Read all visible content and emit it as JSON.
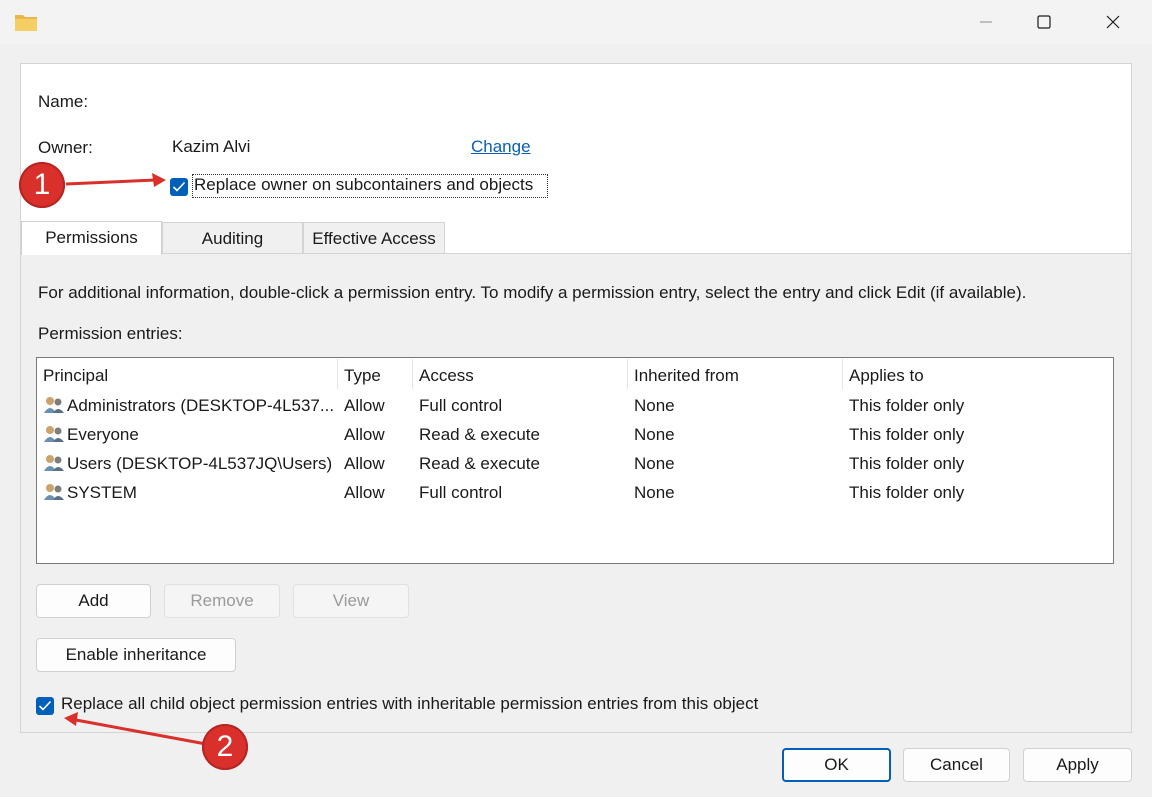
{
  "titlebar": {
    "icons": [
      "folder-icon",
      "minimize-icon",
      "maximize-icon",
      "close-icon"
    ]
  },
  "owner_section": {
    "name_label": "Name:",
    "owner_label": "Owner:",
    "owner_value": "Kazim Alvi",
    "change_link": "Change",
    "replace_owner_label": "Replace owner on subcontainers and objects",
    "replace_owner_checked": true
  },
  "tabs": [
    {
      "label": "Permissions",
      "active": true
    },
    {
      "label": "Auditing",
      "active": false
    },
    {
      "label": "Effective Access",
      "active": false
    }
  ],
  "info_text": "For additional information, double-click a permission entry. To modify a permission entry, select the entry and click Edit (if available).",
  "entries_label": "Permission entries:",
  "table": {
    "columns": [
      "Principal",
      "Type",
      "Access",
      "Inherited from",
      "Applies to"
    ],
    "rows": [
      {
        "principal": "Administrators (DESKTOP-4L537...",
        "type": "Allow",
        "access": "Full control",
        "inherited": "None",
        "applies": "This folder only"
      },
      {
        "principal": "Everyone",
        "type": "Allow",
        "access": "Read & execute",
        "inherited": "None",
        "applies": "This folder only"
      },
      {
        "principal": "Users (DESKTOP-4L537JQ\\Users)",
        "type": "Allow",
        "access": "Read & execute",
        "inherited": "None",
        "applies": "This folder only"
      },
      {
        "principal": "SYSTEM",
        "type": "Allow",
        "access": "Full control",
        "inherited": "None",
        "applies": "This folder only"
      }
    ]
  },
  "buttons": {
    "add": "Add",
    "remove": "Remove",
    "view": "View",
    "enable_inheritance": "Enable inheritance",
    "ok": "OK",
    "cancel": "Cancel",
    "apply": "Apply"
  },
  "replace_child": {
    "label": "Replace all child object permission entries with inheritable permission entries from this object",
    "checked": true
  },
  "annotations": {
    "badge1": "1",
    "badge2": "2",
    "color": "#d9302c"
  }
}
